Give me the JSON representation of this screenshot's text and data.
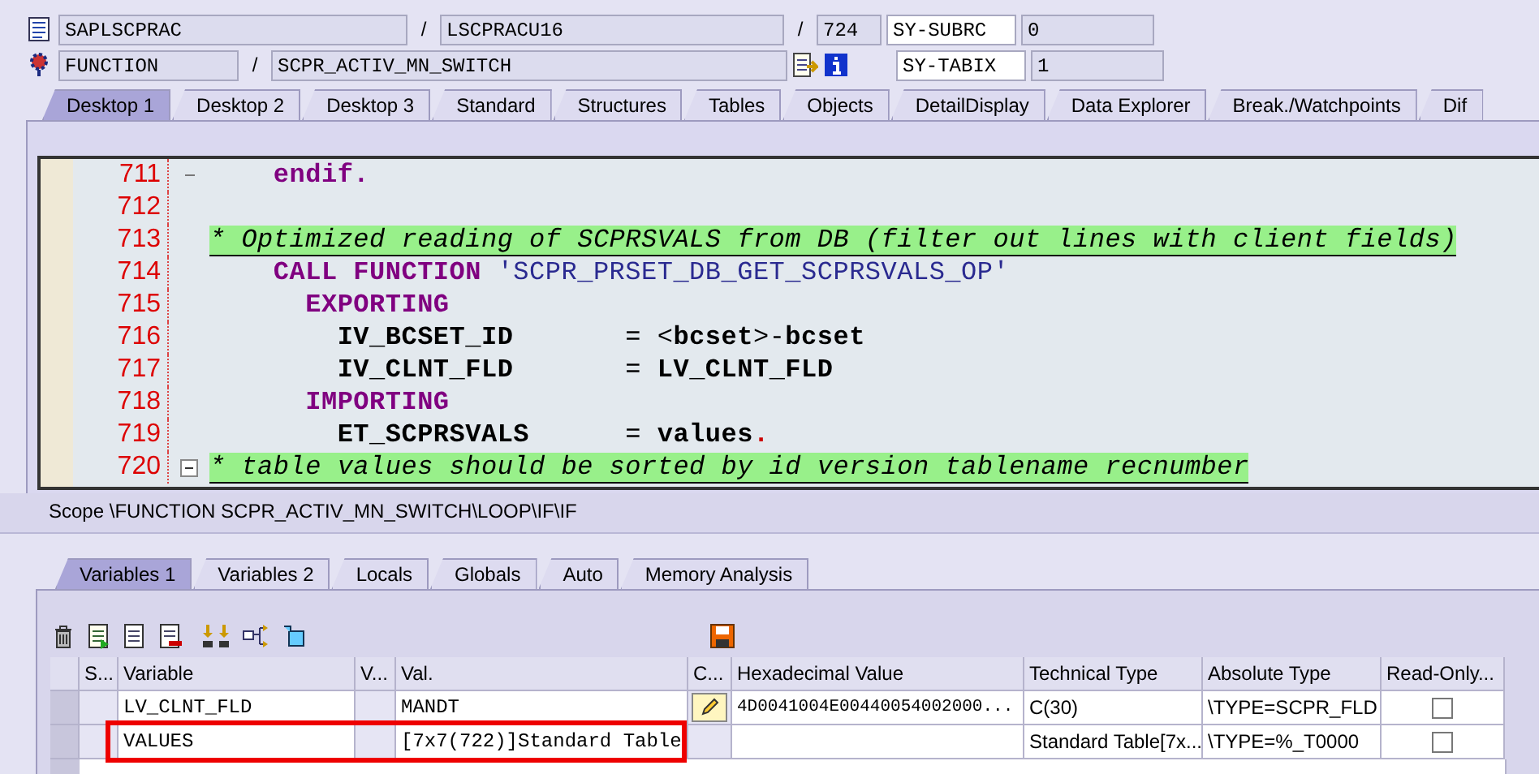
{
  "program_row": {
    "program": "SAPLSCPRAC",
    "separator_1": "/",
    "include": "LSCPRACU16",
    "separator_2": "/",
    "line": "724",
    "field_name": "SY-SUBRC",
    "field_value": "0"
  },
  "event_row": {
    "event_type": "FUNCTION",
    "separator": "/",
    "event_name": "SCPR_ACTIV_MN_SWITCH",
    "field_name": "SY-TABIX",
    "field_value": "1"
  },
  "desktop_tabs": [
    {
      "label": "Desktop 1",
      "selected": true
    },
    {
      "label": "Desktop 2",
      "selected": false
    },
    {
      "label": "Desktop 3",
      "selected": false
    },
    {
      "label": "Standard",
      "selected": false
    },
    {
      "label": "Structures",
      "selected": false
    },
    {
      "label": "Tables",
      "selected": false
    },
    {
      "label": "Objects",
      "selected": false
    },
    {
      "label": "DetailDisplay",
      "selected": false
    },
    {
      "label": "Data Explorer",
      "selected": false
    },
    {
      "label": "Break./Watchpoints",
      "selected": false
    },
    {
      "label": "Dif",
      "selected": false
    }
  ],
  "code_lines": [
    {
      "number": "711",
      "kind": "fold_end",
      "segments": [
        {
          "kind": "kw",
          "text": "    endif."
        }
      ]
    },
    {
      "number": "712",
      "kind": "plain"
    },
    {
      "number": "713",
      "kind": "plain",
      "segments": [
        {
          "kind": "comment",
          "text": "* Optimized reading of SCPRSVALS from DB (filter out lines with client fields)"
        }
      ]
    },
    {
      "number": "714",
      "kind": "plain",
      "segments": [
        {
          "kind": "kw",
          "text": "    CALL FUNCTION "
        },
        {
          "kind": "str",
          "text": "'SCPR_PRSET_DB_GET_SCPRSVALS_OP'"
        }
      ]
    },
    {
      "number": "715",
      "kind": "plain",
      "segments": [
        {
          "kind": "kw",
          "text": "      EXPORTING"
        }
      ]
    },
    {
      "number": "716",
      "kind": "plain",
      "segments": [
        {
          "kind": "name",
          "text": "        IV_BCSET_ID"
        },
        {
          "kind": "op",
          "text": "       = <"
        },
        {
          "kind": "name",
          "text": "bcset"
        },
        {
          "kind": "op",
          "text": ">-"
        },
        {
          "kind": "name",
          "text": "bcset"
        }
      ]
    },
    {
      "number": "717",
      "kind": "plain",
      "segments": [
        {
          "kind": "name",
          "text": "        IV_CLNT_FLD"
        },
        {
          "kind": "op",
          "text": "       = "
        },
        {
          "kind": "name",
          "text": "LV_CLNT_FLD"
        }
      ]
    },
    {
      "number": "718",
      "kind": "plain",
      "segments": [
        {
          "kind": "kw",
          "text": "      IMPORTING"
        }
      ]
    },
    {
      "number": "719",
      "kind": "plain",
      "segments": [
        {
          "kind": "name",
          "text": "        ET_SCPRSVALS"
        },
        {
          "kind": "op",
          "text": "      = "
        },
        {
          "kind": "name",
          "text": "values"
        },
        {
          "kind": "dot",
          "text": "."
        }
      ]
    },
    {
      "number": "720",
      "kind": "fold_start",
      "segments": [
        {
          "kind": "comment",
          "text": "* table values should be sorted by id version tablename recnumber"
        }
      ]
    }
  ],
  "scope": "Scope \\FUNCTION SCPR_ACTIV_MN_SWITCH\\LOOP\\IF\\IF",
  "variable_tabs": [
    {
      "label": "Variables 1",
      "selected": true
    },
    {
      "label": "Variables 2",
      "selected": false
    },
    {
      "label": "Locals",
      "selected": false
    },
    {
      "label": "Globals",
      "selected": false
    },
    {
      "label": "Auto",
      "selected": false
    },
    {
      "label": "Memory Analysis",
      "selected": false
    }
  ],
  "table": {
    "columns": [
      "S...",
      "Variable",
      "V...",
      "Val.",
      "C...",
      "Hexadecimal Value",
      "Technical Type",
      "Absolute Type",
      "Read-Only..."
    ],
    "rows": [
      {
        "variable": "LV_CLNT_FLD",
        "value": "MANDT",
        "editable": true,
        "hex": "4D0041004E00440054002000...",
        "technical_type": "C(30)",
        "absolute_type": "\\TYPE=SCPR_FLD",
        "read_only": false,
        "highlighted": false
      },
      {
        "variable": "VALUES",
        "value": "[7x7(722)]Standard Table",
        "editable": false,
        "technical_type": "Standard Table[7x...",
        "absolute_type": "\\TYPE=%_T0000",
        "read_only": false,
        "highlighted": true
      }
    ]
  }
}
